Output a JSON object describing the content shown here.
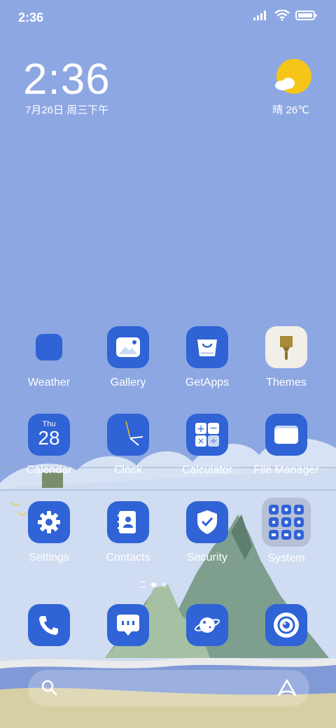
{
  "status_bar": {
    "time": "2:36",
    "icons": [
      "signal-icon",
      "wifi-icon",
      "battery-icon"
    ]
  },
  "clock_widget": {
    "time": "2:36",
    "date": "7月26日 周三下午"
  },
  "weather_widget": {
    "condition_icon": "sun-cloud-icon",
    "text": "晴 26℃"
  },
  "apps": [
    {
      "label": "Weather",
      "icon": "weather-icon"
    },
    {
      "label": "Gallery",
      "icon": "gallery-icon"
    },
    {
      "label": "GetApps",
      "icon": "getapps-icon"
    },
    {
      "label": "Themes",
      "icon": "themes-brush-icon"
    },
    {
      "label": "Calendar",
      "icon": "calendar-icon",
      "day": "Thu",
      "date": "28"
    },
    {
      "label": "Clock",
      "icon": "clock-icon"
    },
    {
      "label": "Calculator",
      "icon": "calculator-icon"
    },
    {
      "label": "File Manager",
      "icon": "folder-icon"
    },
    {
      "label": "Settings",
      "icon": "gear-icon"
    },
    {
      "label": "Contacts",
      "icon": "contacts-icon"
    },
    {
      "label": "Security",
      "icon": "shield-check-icon"
    },
    {
      "label": "System",
      "icon": "system-folder-icon"
    }
  ],
  "page_indicator": {
    "pages": 2,
    "active": 1
  },
  "dock": [
    {
      "icon": "phone-icon"
    },
    {
      "icon": "messages-icon"
    },
    {
      "icon": "browser-planet-icon"
    },
    {
      "icon": "camera-icon"
    }
  ],
  "search_bar": {
    "left_icon": "search-icon",
    "right_icon": "assistant-icon"
  },
  "colors": {
    "icon_blue": "#2f63d6",
    "sky": "#8da7e2",
    "themes_bg": "#f1efe8",
    "system_bg": "#b6c0d6"
  }
}
